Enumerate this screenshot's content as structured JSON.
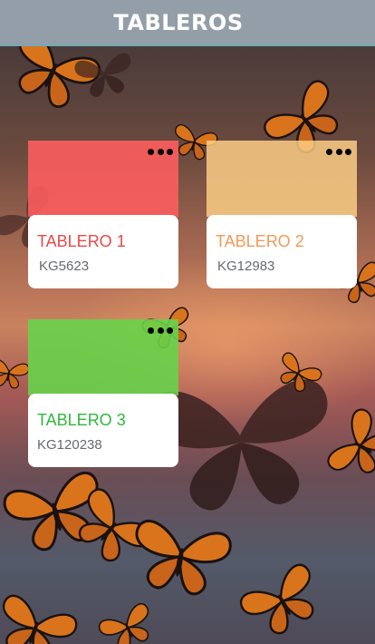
{
  "header": {
    "title": "TABLEROS"
  },
  "boards": [
    {
      "name": "TABLERO 1",
      "code": "KG5623",
      "menu_icon": "more-horizontal-icon"
    },
    {
      "name": "TABLERO 2",
      "code": "KG12983",
      "menu_icon": "more-horizontal-icon"
    },
    {
      "name": "TABLERO 3",
      "code": "KG120238",
      "menu_icon": "more-horizontal-icon"
    }
  ],
  "colors": {
    "header_bg": "#949ea8",
    "board_1": "#ff5d5f",
    "board_2": "#ffd287",
    "board_3": "#68d34a"
  }
}
